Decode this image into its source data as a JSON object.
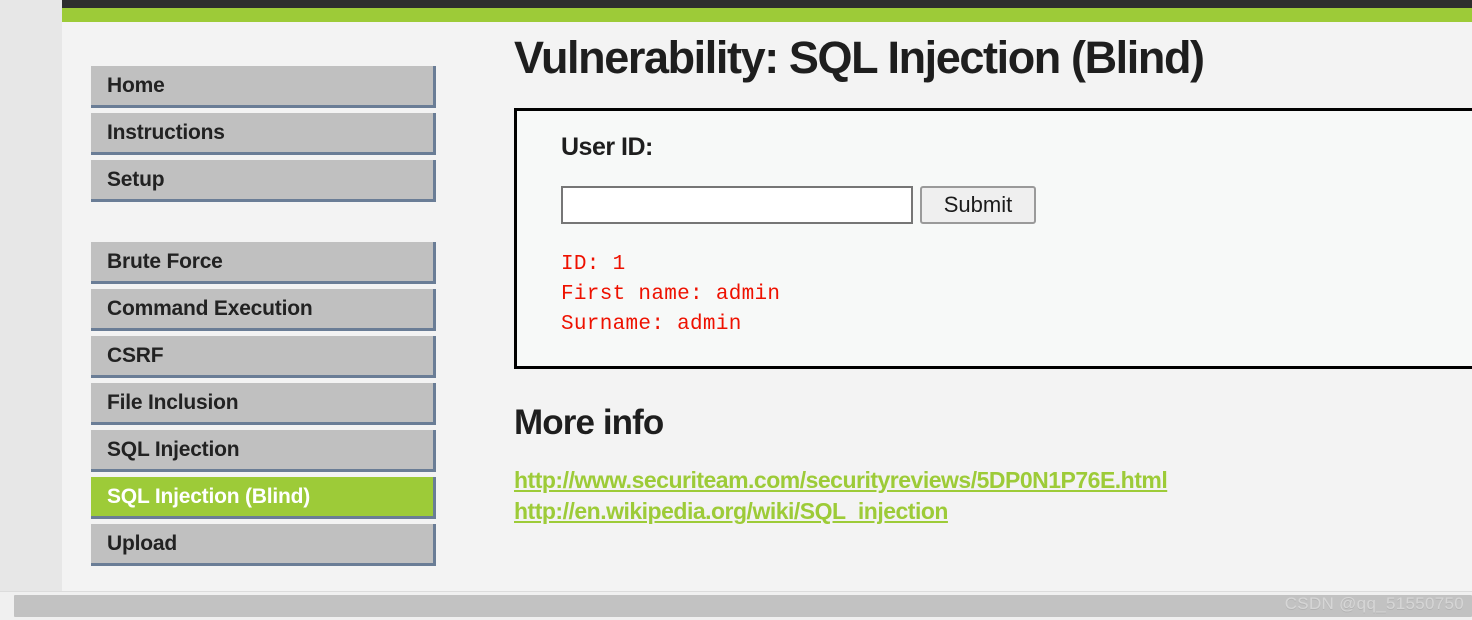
{
  "theme": {
    "top_bar_dark": "#2e2e2e",
    "accent_green": "#9dcb38",
    "page_background": "#f3f3f3",
    "nav_background": "#c0c0c0",
    "nav_border": "#6a7d96",
    "result_text": "#ee1100",
    "link_color": "#9dcb38",
    "box_border": "#000000"
  },
  "sidebar": {
    "groups": [
      {
        "items": [
          {
            "label": "Home",
            "active": false
          },
          {
            "label": "Instructions",
            "active": false
          },
          {
            "label": "Setup",
            "active": false
          }
        ]
      },
      {
        "items": [
          {
            "label": "Brute Force",
            "active": false
          },
          {
            "label": "Command Execution",
            "active": false
          },
          {
            "label": "CSRF",
            "active": false
          },
          {
            "label": "File Inclusion",
            "active": false
          },
          {
            "label": "SQL Injection",
            "active": false
          },
          {
            "label": "SQL Injection (Blind)",
            "active": true
          },
          {
            "label": "Upload",
            "active": false
          }
        ]
      }
    ]
  },
  "main": {
    "page_title": "Vulnerability: SQL Injection (Blind)",
    "form": {
      "label": "User ID:",
      "input_value": "",
      "input_placeholder": "",
      "submit_label": "Submit"
    },
    "result": {
      "lines": [
        "ID: 1",
        "First name: admin",
        "Surname: admin"
      ]
    },
    "more_info": {
      "heading": "More info",
      "links": [
        "http://www.securiteam.com/securityreviews/5DP0N1P76E.html",
        "http://en.wikipedia.org/wiki/SQL_injection"
      ]
    }
  },
  "scrollbar": {
    "orientation": "horizontal",
    "watermark": "CSDN @qq_51550750"
  }
}
